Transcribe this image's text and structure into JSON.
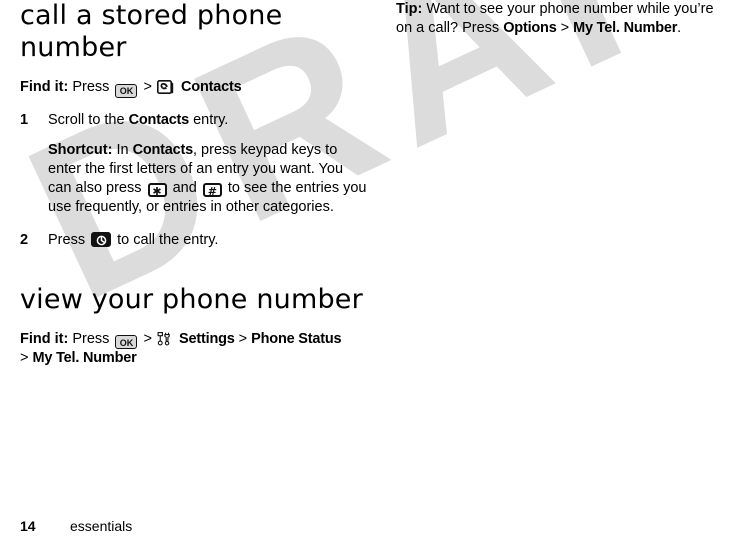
{
  "document": {
    "watermark": "DRAFT",
    "footer": {
      "page_number": "14",
      "chapter": "essentials"
    }
  },
  "left_column": {
    "section1": {
      "title": "call a stored phone number",
      "find_it": {
        "lead": "Find it:",
        "press_word": "Press",
        "ok_key_label": "OK",
        "separator": ">",
        "target_icon": "contacts-icon",
        "target_label": "Contacts"
      },
      "steps": [
        {
          "number": "1",
          "text_before": "Scroll to the",
          "ui_label": "Contacts",
          "text_after": "entry.",
          "note": {
            "lead": "Shortcut:",
            "part1": "In",
            "ui_label": "Contacts",
            "part2": ", press keypad keys to enter the first letters of an entry you want. You can also press",
            "star_key": "✱",
            "part3": "and",
            "pound_key": "#",
            "part4": "to see the entries you use frequently, or entries in other categories."
          }
        },
        {
          "number": "2",
          "text_before": "Press",
          "send_key": "send-key",
          "text_after": "to call the entry."
        }
      ]
    },
    "section2": {
      "title": "view your phone number",
      "find_it": {
        "lead": "Find it:",
        "press_word": "Press",
        "ok_key_label": "OK",
        "sep1": ">",
        "settings_icon": "settings-tools-icon",
        "settings_label": "Settings",
        "sep2": ">",
        "phone_status_label": "Phone Status",
        "sep3": ">",
        "my_tel_label": "My Tel. Number"
      }
    }
  },
  "right_column": {
    "tip": {
      "lead": "Tip:",
      "part1": "Want to see your phone number while you’re on a call? Press",
      "options_label": "Options",
      "separator": ">",
      "my_tel_label": "My Tel. Number",
      "period": "."
    }
  },
  "colors": {
    "text": "#000000",
    "watermark": "#dcdcdc",
    "key_fill": "#d9d9d9",
    "key_border": "#111111",
    "background": "#ffffff"
  }
}
